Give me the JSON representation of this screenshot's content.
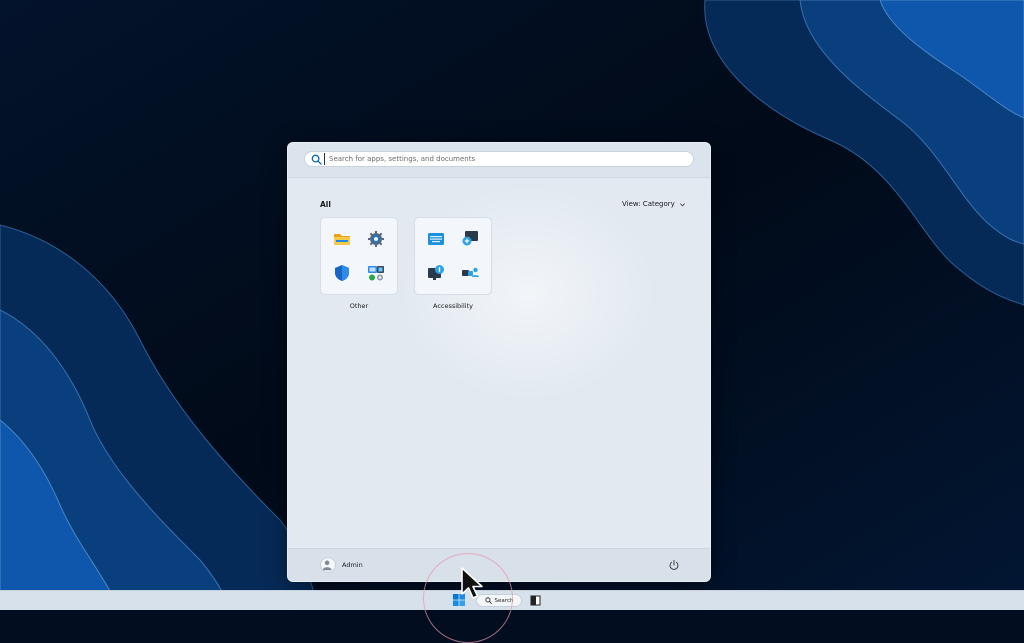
{
  "search": {
    "placeholder": "Search for apps, settings, and documents"
  },
  "section": {
    "title": "All"
  },
  "view": {
    "label": "View: Category"
  },
  "categories": [
    {
      "label": "Other",
      "icons": [
        "file-explorer-icon",
        "settings-gear-icon",
        "windows-security-shield-icon",
        "control-panel-icon"
      ]
    },
    {
      "label": "Accessibility",
      "icons": [
        "on-screen-keyboard-icon",
        "magnifier-icon",
        "narrator-icon",
        "voice-access-icon"
      ]
    }
  ],
  "footer": {
    "user_name": "Admin"
  },
  "taskbar": {
    "search_label": "Search"
  },
  "colors": {
    "accent": "#0078d4",
    "menu_bg": "#e2e9f1",
    "wallpaper_dark": "#020d1f",
    "wallpaper_blue": "#0a5bb5"
  }
}
